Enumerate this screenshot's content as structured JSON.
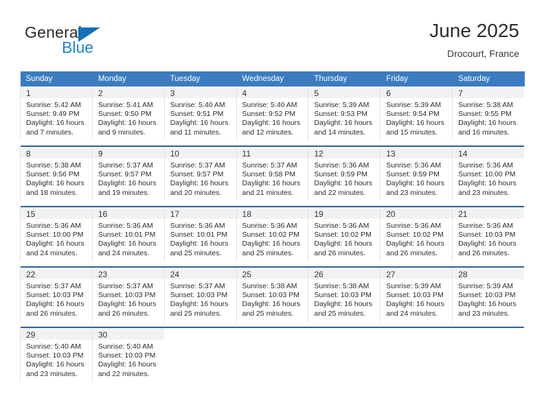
{
  "brand": {
    "word1": "General",
    "word2": "Blue",
    "triangle_color": "#1470b8",
    "word2_color": "#1f82d0"
  },
  "header": {
    "title": "June 2025",
    "subtitle": "Drocourt, France",
    "header_bg": "#3b7cc0",
    "week_separator_color": "#2f6296",
    "daynum_bg": "#f2f2f2"
  },
  "weekday_headers": [
    "Sunday",
    "Monday",
    "Tuesday",
    "Wednesday",
    "Thursday",
    "Friday",
    "Saturday"
  ],
  "weeks": [
    [
      {
        "day": "1",
        "sunrise": "Sunrise: 5:42 AM",
        "sunset": "Sunset: 9:49 PM",
        "daylight_line1": "Daylight: 16 hours",
        "daylight_line2": "and 7 minutes."
      },
      {
        "day": "2",
        "sunrise": "Sunrise: 5:41 AM",
        "sunset": "Sunset: 9:50 PM",
        "daylight_line1": "Daylight: 16 hours",
        "daylight_line2": "and 9 minutes."
      },
      {
        "day": "3",
        "sunrise": "Sunrise: 5:40 AM",
        "sunset": "Sunset: 9:51 PM",
        "daylight_line1": "Daylight: 16 hours",
        "daylight_line2": "and 11 minutes."
      },
      {
        "day": "4",
        "sunrise": "Sunrise: 5:40 AM",
        "sunset": "Sunset: 9:52 PM",
        "daylight_line1": "Daylight: 16 hours",
        "daylight_line2": "and 12 minutes."
      },
      {
        "day": "5",
        "sunrise": "Sunrise: 5:39 AM",
        "sunset": "Sunset: 9:53 PM",
        "daylight_line1": "Daylight: 16 hours",
        "daylight_line2": "and 14 minutes."
      },
      {
        "day": "6",
        "sunrise": "Sunrise: 5:39 AM",
        "sunset": "Sunset: 9:54 PM",
        "daylight_line1": "Daylight: 16 hours",
        "daylight_line2": "and 15 minutes."
      },
      {
        "day": "7",
        "sunrise": "Sunrise: 5:38 AM",
        "sunset": "Sunset: 9:55 PM",
        "daylight_line1": "Daylight: 16 hours",
        "daylight_line2": "and 16 minutes."
      }
    ],
    [
      {
        "day": "8",
        "sunrise": "Sunrise: 5:38 AM",
        "sunset": "Sunset: 9:56 PM",
        "daylight_line1": "Daylight: 16 hours",
        "daylight_line2": "and 18 minutes."
      },
      {
        "day": "9",
        "sunrise": "Sunrise: 5:37 AM",
        "sunset": "Sunset: 9:57 PM",
        "daylight_line1": "Daylight: 16 hours",
        "daylight_line2": "and 19 minutes."
      },
      {
        "day": "10",
        "sunrise": "Sunrise: 5:37 AM",
        "sunset": "Sunset: 9:57 PM",
        "daylight_line1": "Daylight: 16 hours",
        "daylight_line2": "and 20 minutes."
      },
      {
        "day": "11",
        "sunrise": "Sunrise: 5:37 AM",
        "sunset": "Sunset: 9:58 PM",
        "daylight_line1": "Daylight: 16 hours",
        "daylight_line2": "and 21 minutes."
      },
      {
        "day": "12",
        "sunrise": "Sunrise: 5:36 AM",
        "sunset": "Sunset: 9:59 PM",
        "daylight_line1": "Daylight: 16 hours",
        "daylight_line2": "and 22 minutes."
      },
      {
        "day": "13",
        "sunrise": "Sunrise: 5:36 AM",
        "sunset": "Sunset: 9:59 PM",
        "daylight_line1": "Daylight: 16 hours",
        "daylight_line2": "and 23 minutes."
      },
      {
        "day": "14",
        "sunrise": "Sunrise: 5:36 AM",
        "sunset": "Sunset: 10:00 PM",
        "daylight_line1": "Daylight: 16 hours",
        "daylight_line2": "and 23 minutes."
      }
    ],
    [
      {
        "day": "15",
        "sunrise": "Sunrise: 5:36 AM",
        "sunset": "Sunset: 10:00 PM",
        "daylight_line1": "Daylight: 16 hours",
        "daylight_line2": "and 24 minutes."
      },
      {
        "day": "16",
        "sunrise": "Sunrise: 5:36 AM",
        "sunset": "Sunset: 10:01 PM",
        "daylight_line1": "Daylight: 16 hours",
        "daylight_line2": "and 24 minutes."
      },
      {
        "day": "17",
        "sunrise": "Sunrise: 5:36 AM",
        "sunset": "Sunset: 10:01 PM",
        "daylight_line1": "Daylight: 16 hours",
        "daylight_line2": "and 25 minutes."
      },
      {
        "day": "18",
        "sunrise": "Sunrise: 5:36 AM",
        "sunset": "Sunset: 10:02 PM",
        "daylight_line1": "Daylight: 16 hours",
        "daylight_line2": "and 25 minutes."
      },
      {
        "day": "19",
        "sunrise": "Sunrise: 5:36 AM",
        "sunset": "Sunset: 10:02 PM",
        "daylight_line1": "Daylight: 16 hours",
        "daylight_line2": "and 26 minutes."
      },
      {
        "day": "20",
        "sunrise": "Sunrise: 5:36 AM",
        "sunset": "Sunset: 10:02 PM",
        "daylight_line1": "Daylight: 16 hours",
        "daylight_line2": "and 26 minutes."
      },
      {
        "day": "21",
        "sunrise": "Sunrise: 5:36 AM",
        "sunset": "Sunset: 10:03 PM",
        "daylight_line1": "Daylight: 16 hours",
        "daylight_line2": "and 26 minutes."
      }
    ],
    [
      {
        "day": "22",
        "sunrise": "Sunrise: 5:37 AM",
        "sunset": "Sunset: 10:03 PM",
        "daylight_line1": "Daylight: 16 hours",
        "daylight_line2": "and 26 minutes."
      },
      {
        "day": "23",
        "sunrise": "Sunrise: 5:37 AM",
        "sunset": "Sunset: 10:03 PM",
        "daylight_line1": "Daylight: 16 hours",
        "daylight_line2": "and 26 minutes."
      },
      {
        "day": "24",
        "sunrise": "Sunrise: 5:37 AM",
        "sunset": "Sunset: 10:03 PM",
        "daylight_line1": "Daylight: 16 hours",
        "daylight_line2": "and 25 minutes."
      },
      {
        "day": "25",
        "sunrise": "Sunrise: 5:38 AM",
        "sunset": "Sunset: 10:03 PM",
        "daylight_line1": "Daylight: 16 hours",
        "daylight_line2": "and 25 minutes."
      },
      {
        "day": "26",
        "sunrise": "Sunrise: 5:38 AM",
        "sunset": "Sunset: 10:03 PM",
        "daylight_line1": "Daylight: 16 hours",
        "daylight_line2": "and 25 minutes."
      },
      {
        "day": "27",
        "sunrise": "Sunrise: 5:39 AM",
        "sunset": "Sunset: 10:03 PM",
        "daylight_line1": "Daylight: 16 hours",
        "daylight_line2": "and 24 minutes."
      },
      {
        "day": "28",
        "sunrise": "Sunrise: 5:39 AM",
        "sunset": "Sunset: 10:03 PM",
        "daylight_line1": "Daylight: 16 hours",
        "daylight_line2": "and 23 minutes."
      }
    ],
    [
      {
        "day": "29",
        "sunrise": "Sunrise: 5:40 AM",
        "sunset": "Sunset: 10:03 PM",
        "daylight_line1": "Daylight: 16 hours",
        "daylight_line2": "and 23 minutes."
      },
      {
        "day": "30",
        "sunrise": "Sunrise: 5:40 AM",
        "sunset": "Sunset: 10:03 PM",
        "daylight_line1": "Daylight: 16 hours",
        "daylight_line2": "and 22 minutes."
      },
      {
        "day": "",
        "sunrise": "",
        "sunset": "",
        "daylight_line1": "",
        "daylight_line2": ""
      },
      {
        "day": "",
        "sunrise": "",
        "sunset": "",
        "daylight_line1": "",
        "daylight_line2": ""
      },
      {
        "day": "",
        "sunrise": "",
        "sunset": "",
        "daylight_line1": "",
        "daylight_line2": ""
      },
      {
        "day": "",
        "sunrise": "",
        "sunset": "",
        "daylight_line1": "",
        "daylight_line2": ""
      },
      {
        "day": "",
        "sunrise": "",
        "sunset": "",
        "daylight_line1": "",
        "daylight_line2": ""
      }
    ]
  ]
}
